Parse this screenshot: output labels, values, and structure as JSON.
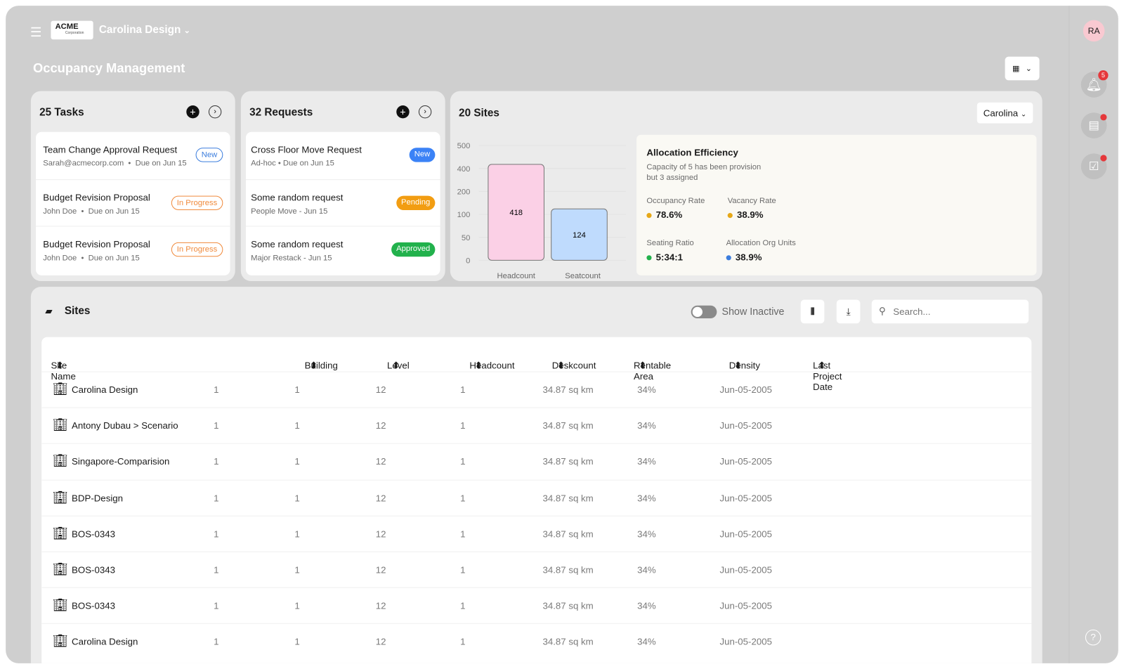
{
  "header": {
    "org": "Carolina Design",
    "logo_text": "ACME",
    "logo_sub": "Corporation",
    "page_title": "Occupancy Management",
    "avatar": "RA",
    "notification_count": "5"
  },
  "tasks": {
    "title": "25 Tasks",
    "items": [
      {
        "title": "Team Change Approval Request",
        "meta1": "Sarah@acmecorp.com",
        "meta2": "Due on Jun 15",
        "status": "New"
      },
      {
        "title": "Budget Revision Proposal",
        "meta1": "John Doe",
        "meta2": "Due on Jun 15",
        "status": "In Progress"
      },
      {
        "title": "Budget Revision Proposal",
        "meta1": "John Doe",
        "meta2": "Due on Jun 15",
        "status": "In Progress"
      }
    ]
  },
  "requests": {
    "title": "32 Requests",
    "items": [
      {
        "title": "Cross Floor Move Request",
        "meta": "Ad-hoc  •  Due on Jun 15",
        "status": "New"
      },
      {
        "title": "Some random request",
        "meta": "People Move - Jun 15",
        "status": "Pending"
      },
      {
        "title": "Some random request",
        "meta": "Major Restack - Jun 15",
        "status": "Approved"
      }
    ]
  },
  "sites_card": {
    "title": "20 Sites",
    "filter": "Carolina",
    "efficiency": {
      "title": "Allocation Efficiency",
      "desc1": "Capacity of 5 has been provision",
      "desc2": "but 3 assigned",
      "metrics": [
        {
          "label": "Occupancy Rate",
          "value": "78.6%",
          "color": "#e6a817"
        },
        {
          "label": "Vacancy Rate",
          "value": "38.9%",
          "color": "#e6a817"
        },
        {
          "label": "Seating Ratio",
          "value": "5:34:1",
          "color": "#22b14c"
        },
        {
          "label": "Allocation Org Units",
          "value": "38.9%",
          "color": "#3b7ddd"
        }
      ]
    }
  },
  "chart_data": {
    "type": "bar",
    "categories": [
      "Headcount",
      "Seatcount"
    ],
    "values": [
      418,
      124
    ],
    "y_ticks": [
      500,
      400,
      200,
      100,
      50,
      0
    ],
    "colors": [
      "#fbd0e6",
      "#bfdbfd"
    ],
    "grid": true
  },
  "table": {
    "title": "Sites",
    "show_inactive": "Show Inactive",
    "search_placeholder": "Search...",
    "columns": [
      "Site Name",
      "Building",
      "Level",
      "Headcount",
      "Deskcount",
      "Rentable Area",
      "Density",
      "Last Project Date"
    ],
    "rows": [
      [
        "Carolina Design",
        "1",
        "1",
        "12",
        "1",
        "34.87 sq km",
        "34%",
        "Jun-05-2005"
      ],
      [
        "Antony Dubau > Scenario",
        "1",
        "1",
        "12",
        "1",
        "34.87 sq km",
        "34%",
        "Jun-05-2005"
      ],
      [
        "Singapore-Comparision",
        "1",
        "1",
        "12",
        "1",
        "34.87 sq km",
        "34%",
        "Jun-05-2005"
      ],
      [
        "BDP-Design",
        "1",
        "1",
        "12",
        "1",
        "34.87 sq km",
        "34%",
        "Jun-05-2005"
      ],
      [
        "BOS-0343",
        "1",
        "1",
        "12",
        "1",
        "34.87 sq km",
        "34%",
        "Jun-05-2005"
      ],
      [
        "BOS-0343",
        "1",
        "1",
        "12",
        "1",
        "34.87 sq km",
        "34%",
        "Jun-05-2005"
      ],
      [
        "BOS-0343",
        "1",
        "1",
        "12",
        "1",
        "34.87 sq km",
        "34%",
        "Jun-05-2005"
      ],
      [
        "Carolina Design",
        "1",
        "1",
        "12",
        "1",
        "34.87 sq km",
        "34%",
        "Jun-05-2005"
      ]
    ]
  }
}
